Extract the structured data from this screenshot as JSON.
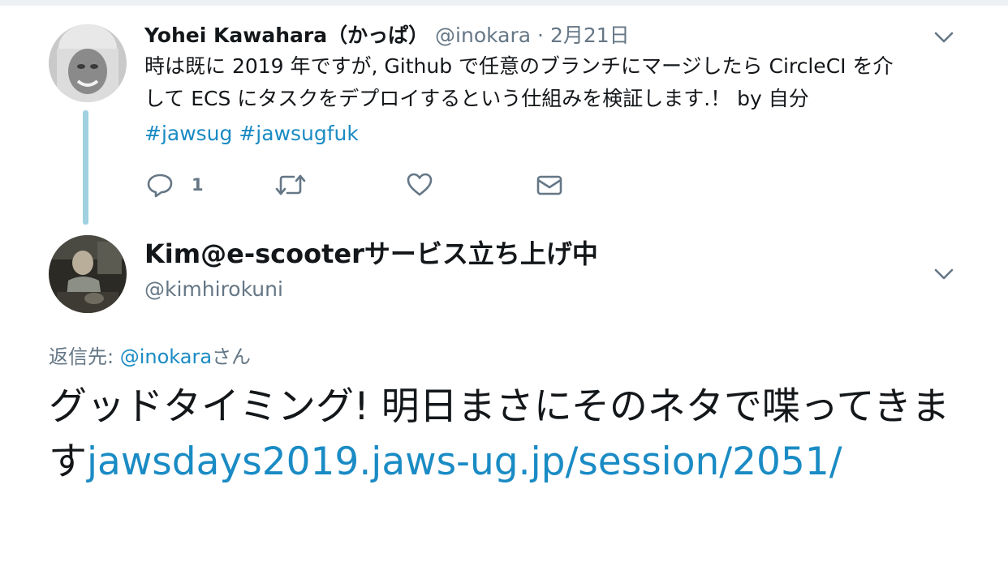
{
  "parent_tweet": {
    "display_name": "Yohei Kawahara（かっぱ）",
    "handle": "@inokara",
    "date_separator": "·",
    "date": "2月21日",
    "text_line1": "時は既に 2019 年ですが, Github で任意のブランチにマージしたら CircleCI を介",
    "text_line2": "して ECS にタスクをデプロイするという仕組みを検証します.！ by 自分",
    "hashtags": [
      "#jawsug",
      "#jawsugfuk"
    ],
    "reply_count": "1",
    "icons": {
      "reply": "reply-icon",
      "retweet": "retweet-icon",
      "like": "heart-icon",
      "dm": "envelope-icon",
      "menu": "chevron-down-icon"
    }
  },
  "reply_tweet": {
    "display_name": "Kim@e-scooterサービス立ち上げ中",
    "handle": "@kimhirokuni",
    "replying_to_label": "返信先: ",
    "replying_to_mention": "@inokara",
    "replying_to_suffix": "さん",
    "text": "グッドタイミング! 明日まさにそのネタで喋ってきます",
    "link_text": "jawsdays2019.jaws-ug.jp/session/2051/"
  },
  "colors": {
    "link": "#1a8bc4",
    "secondary_text": "#657786",
    "thread_line": "#9fd1e0",
    "primary_text": "#14171a"
  }
}
